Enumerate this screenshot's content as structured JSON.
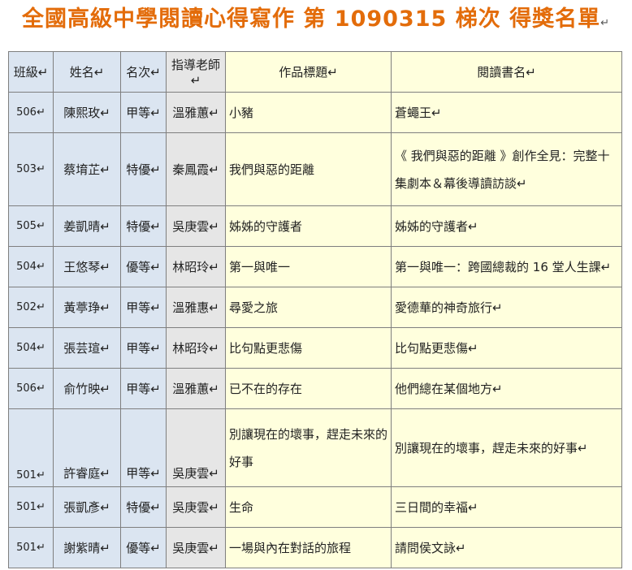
{
  "title": "全國高級中學閱讀心得寫作 第 1090315 梯次 得獎名單",
  "title_mark": "↵",
  "colors": {
    "title": "#e36c0a",
    "left_columns_bg": "#dbe5f1",
    "teacher_column_bg": "#e6e6e6",
    "text_columns_bg": "#ffffdd",
    "border": "#7f7f7f"
  },
  "headers": {
    "class": "班級↵",
    "name": "姓名↵",
    "rank": "名次↵",
    "teacher": "指導老師↵",
    "work": "作品標題↵",
    "book": "閱讀書名↵"
  },
  "rows": [
    {
      "class": "506↵",
      "name": "陳熙玫↵",
      "rank": "甲等↵",
      "teacher": "溫雅蕙↵",
      "work": "小豬",
      "book": "蒼蠅王↵"
    },
    {
      "class": "503↵",
      "name": "蔡堉芷↵",
      "rank": "特優↵",
      "teacher": "秦鳳霞↵",
      "work": "我們與惡的距離",
      "book": "《 我們與惡的距離 》創作全見：完整十集劇本＆幕後導讀訪談↵"
    },
    {
      "class": "505↵",
      "name": "姜凱晴↵",
      "rank": "特優↵",
      "teacher": "吳庚雲↵",
      "work": "姊姊的守護者",
      "book": "姊姊的守護者↵"
    },
    {
      "class": "504↵",
      "name": "王悠琴↵",
      "rank": "優等↵",
      "teacher": "林昭玲↵",
      "work": "第一與唯一",
      "book": "第一與唯一：跨國總裁的 16 堂人生課↵"
    },
    {
      "class": "502↵",
      "name": "黃葶琤↵",
      "rank": "甲等↵",
      "teacher": "溫雅惠↵",
      "work": "尋愛之旅",
      "book": "愛德華的神奇旅行↵"
    },
    {
      "class": "504↵",
      "name": "張芸瑄↵",
      "rank": "甲等↵",
      "teacher": "林昭玲↵",
      "work": "比句點更悲傷",
      "book": "比句點更悲傷↵"
    },
    {
      "class": "506↵",
      "name": "俞竹映↵",
      "rank": "甲等↵",
      "teacher": "溫雅蕙↵",
      "work": "已不在的存在",
      "book": "他們總在某個地方↵"
    },
    {
      "class": "501↵",
      "name": "許睿庭↵",
      "rank": "甲等↵",
      "teacher": "吳庚雲↵",
      "work": "別讓現在的壞事，趕走未來的好事",
      "book": "別讓現在的壞事，趕走未來的好事↵"
    },
    {
      "class": "501↵",
      "name": "張凱彥↵",
      "rank": "特優↵",
      "teacher": "吳庚雲↵",
      "work": "生命",
      "book": "三日間的幸福↵"
    },
    {
      "class": "501↵",
      "name": "謝紫晴↵",
      "rank": "優等↵",
      "teacher": "吳庚雲↵",
      "work": "一場與內在對話的旅程",
      "book": "請問侯文詠↵"
    }
  ]
}
